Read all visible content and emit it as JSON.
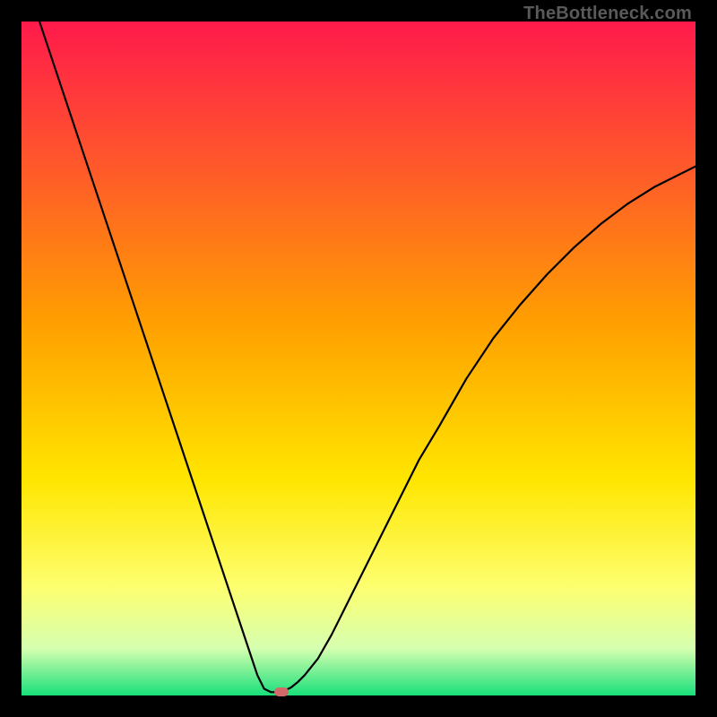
{
  "watermark": {
    "text": "TheBottleneck.com"
  },
  "chart_data": {
    "type": "line",
    "title": "",
    "xlabel": "",
    "ylabel": "",
    "xlim": [
      0,
      100
    ],
    "ylim": [
      0,
      100
    ],
    "grid": false,
    "legend": false,
    "background_gradient_stops": [
      {
        "offset": 0.0,
        "color": "#ff1a4b"
      },
      {
        "offset": 0.22,
        "color": "#ff5a2a"
      },
      {
        "offset": 0.45,
        "color": "#ffa000"
      },
      {
        "offset": 0.68,
        "color": "#ffe600"
      },
      {
        "offset": 0.84,
        "color": "#fdff70"
      },
      {
        "offset": 0.93,
        "color": "#d6ffb0"
      },
      {
        "offset": 1.0,
        "color": "#18e07a"
      }
    ],
    "series": [
      {
        "name": "bottleneck-curve",
        "color": "#000000",
        "x": [
          0,
          2,
          4,
          6,
          8,
          10,
          12,
          14,
          16,
          18,
          20,
          22,
          24,
          26,
          28,
          30,
          32,
          34,
          35,
          36,
          37,
          38,
          39,
          40,
          41,
          42,
          44,
          46,
          48,
          50,
          53,
          56,
          59,
          62,
          66,
          70,
          74,
          78,
          82,
          86,
          90,
          94,
          98,
          100
        ],
        "y": [
          108,
          102,
          96,
          90,
          84,
          78,
          72,
          66,
          60,
          54,
          48,
          42,
          36,
          30,
          24,
          18,
          12,
          6,
          3,
          1,
          0.5,
          0.5,
          0.7,
          1.2,
          2,
          3,
          5.5,
          9,
          13,
          17,
          23,
          29,
          35,
          40,
          47,
          53,
          58,
          62.5,
          66.5,
          70,
          73,
          75.5,
          77.5,
          78.5
        ]
      }
    ],
    "annotations": [
      {
        "name": "optimum-marker",
        "x": 38.5,
        "y": 0.5,
        "color": "#d26a6a",
        "shape": "pill"
      }
    ]
  }
}
